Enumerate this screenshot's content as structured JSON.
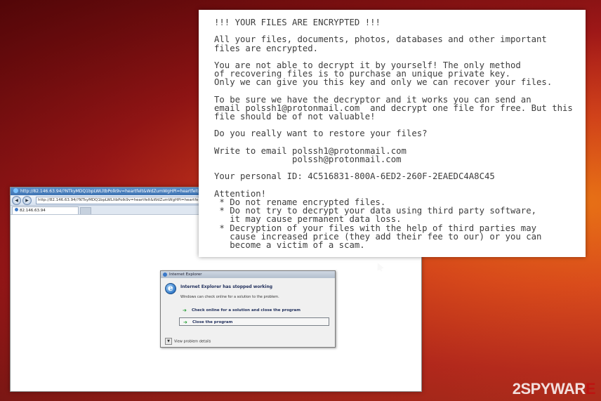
{
  "ie_window": {
    "title": "http://82.146.63.94/?NTkyMDQ1bpLWLltbPolk9v=heartfelt&WdZumWgHPi=heartfelt&",
    "address": "http://82.146.63.94/?NTkyMDQ1bpLWLltbPolk9v=heartfelt&WdZumWgHPi=heartfelt&",
    "tab_label": "82.146.63.94",
    "back_symbol": "◀",
    "forward_symbol": "▶",
    "logo_icon": "internet-explorer-icon"
  },
  "error_dialog": {
    "title": "Internet Explorer",
    "heading": "Internet Explorer has stopped working",
    "message": "Windows can check online for a solution to the problem.",
    "option_check_online": "Check online for a solution and close the program",
    "option_close": "Close the program",
    "details_label": "View problem details",
    "arrow_symbol": "➔",
    "chevron_symbol": "▼"
  },
  "ransom_note": {
    "lines": [
      "!!! YOUR FILES ARE ENCRYPTED !!!",
      "",
      "All your files, documents, photos, databases and other important",
      "files are encrypted.",
      "",
      "You are not able to decrypt it by yourself! The only method",
      "of recovering files is to purchase an unique private key.",
      "Only we can give you this key and only we can recover your files.",
      "",
      "To be sure we have the decryptor and it works you can send an",
      "email polssh1@protonmail.com  and decrypt one file for free. But this",
      "file should be of not valuable!",
      "",
      "Do you really want to restore your files?",
      "",
      "Write to email polssh1@protonmail.com",
      "               polssh@protonmail.com",
      "",
      "Your personal ID: 4C516831-800A-6ED2-260F-2EAEDC4A8C45",
      "",
      "Attention!",
      " * Do not rename encrypted files.",
      " * Do not try to decrypt your data using third party software,",
      "   it may cause permanent data loss.",
      " * Decryption of your files with the help of third parties may",
      "   cause increased price (they add their fee to our) or you can",
      "   become a victim of a scam."
    ]
  },
  "watermark": {
    "prefix": "2",
    "main": "SPYWAR",
    "accent": "E"
  },
  "colors": {
    "background_dark": "#6e0e12",
    "background_bright": "#f07a14",
    "watermark_accent": "#c01010"
  }
}
